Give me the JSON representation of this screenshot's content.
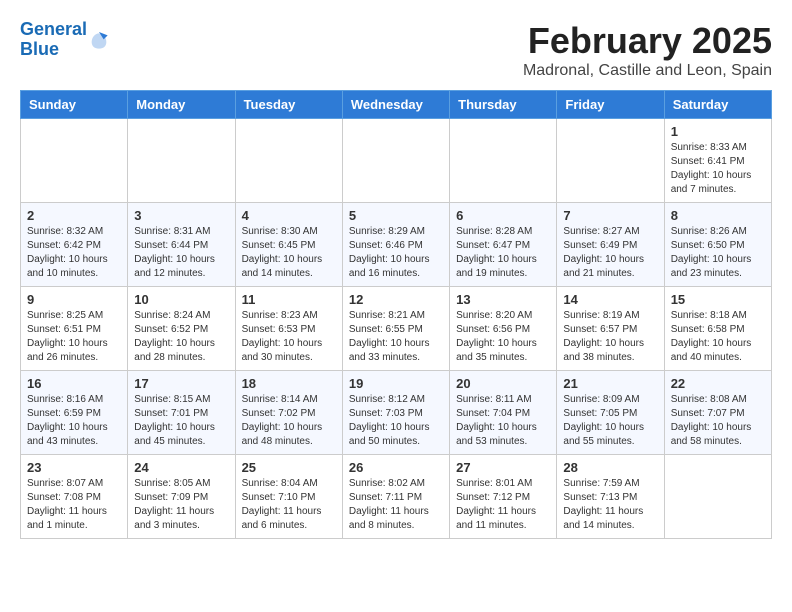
{
  "header": {
    "logo_line1": "General",
    "logo_line2": "Blue",
    "month_year": "February 2025",
    "location": "Madronal, Castille and Leon, Spain"
  },
  "days_of_week": [
    "Sunday",
    "Monday",
    "Tuesday",
    "Wednesday",
    "Thursday",
    "Friday",
    "Saturday"
  ],
  "weeks": [
    [
      {
        "day": "",
        "info": ""
      },
      {
        "day": "",
        "info": ""
      },
      {
        "day": "",
        "info": ""
      },
      {
        "day": "",
        "info": ""
      },
      {
        "day": "",
        "info": ""
      },
      {
        "day": "",
        "info": ""
      },
      {
        "day": "1",
        "info": "Sunrise: 8:33 AM\nSunset: 6:41 PM\nDaylight: 10 hours\nand 7 minutes."
      }
    ],
    [
      {
        "day": "2",
        "info": "Sunrise: 8:32 AM\nSunset: 6:42 PM\nDaylight: 10 hours\nand 10 minutes."
      },
      {
        "day": "3",
        "info": "Sunrise: 8:31 AM\nSunset: 6:44 PM\nDaylight: 10 hours\nand 12 minutes."
      },
      {
        "day": "4",
        "info": "Sunrise: 8:30 AM\nSunset: 6:45 PM\nDaylight: 10 hours\nand 14 minutes."
      },
      {
        "day": "5",
        "info": "Sunrise: 8:29 AM\nSunset: 6:46 PM\nDaylight: 10 hours\nand 16 minutes."
      },
      {
        "day": "6",
        "info": "Sunrise: 8:28 AM\nSunset: 6:47 PM\nDaylight: 10 hours\nand 19 minutes."
      },
      {
        "day": "7",
        "info": "Sunrise: 8:27 AM\nSunset: 6:49 PM\nDaylight: 10 hours\nand 21 minutes."
      },
      {
        "day": "8",
        "info": "Sunrise: 8:26 AM\nSunset: 6:50 PM\nDaylight: 10 hours\nand 23 minutes."
      }
    ],
    [
      {
        "day": "9",
        "info": "Sunrise: 8:25 AM\nSunset: 6:51 PM\nDaylight: 10 hours\nand 26 minutes."
      },
      {
        "day": "10",
        "info": "Sunrise: 8:24 AM\nSunset: 6:52 PM\nDaylight: 10 hours\nand 28 minutes."
      },
      {
        "day": "11",
        "info": "Sunrise: 8:23 AM\nSunset: 6:53 PM\nDaylight: 10 hours\nand 30 minutes."
      },
      {
        "day": "12",
        "info": "Sunrise: 8:21 AM\nSunset: 6:55 PM\nDaylight: 10 hours\nand 33 minutes."
      },
      {
        "day": "13",
        "info": "Sunrise: 8:20 AM\nSunset: 6:56 PM\nDaylight: 10 hours\nand 35 minutes."
      },
      {
        "day": "14",
        "info": "Sunrise: 8:19 AM\nSunset: 6:57 PM\nDaylight: 10 hours\nand 38 minutes."
      },
      {
        "day": "15",
        "info": "Sunrise: 8:18 AM\nSunset: 6:58 PM\nDaylight: 10 hours\nand 40 minutes."
      }
    ],
    [
      {
        "day": "16",
        "info": "Sunrise: 8:16 AM\nSunset: 6:59 PM\nDaylight: 10 hours\nand 43 minutes."
      },
      {
        "day": "17",
        "info": "Sunrise: 8:15 AM\nSunset: 7:01 PM\nDaylight: 10 hours\nand 45 minutes."
      },
      {
        "day": "18",
        "info": "Sunrise: 8:14 AM\nSunset: 7:02 PM\nDaylight: 10 hours\nand 48 minutes."
      },
      {
        "day": "19",
        "info": "Sunrise: 8:12 AM\nSunset: 7:03 PM\nDaylight: 10 hours\nand 50 minutes."
      },
      {
        "day": "20",
        "info": "Sunrise: 8:11 AM\nSunset: 7:04 PM\nDaylight: 10 hours\nand 53 minutes."
      },
      {
        "day": "21",
        "info": "Sunrise: 8:09 AM\nSunset: 7:05 PM\nDaylight: 10 hours\nand 55 minutes."
      },
      {
        "day": "22",
        "info": "Sunrise: 8:08 AM\nSunset: 7:07 PM\nDaylight: 10 hours\nand 58 minutes."
      }
    ],
    [
      {
        "day": "23",
        "info": "Sunrise: 8:07 AM\nSunset: 7:08 PM\nDaylight: 11 hours\nand 1 minute."
      },
      {
        "day": "24",
        "info": "Sunrise: 8:05 AM\nSunset: 7:09 PM\nDaylight: 11 hours\nand 3 minutes."
      },
      {
        "day": "25",
        "info": "Sunrise: 8:04 AM\nSunset: 7:10 PM\nDaylight: 11 hours\nand 6 minutes."
      },
      {
        "day": "26",
        "info": "Sunrise: 8:02 AM\nSunset: 7:11 PM\nDaylight: 11 hours\nand 8 minutes."
      },
      {
        "day": "27",
        "info": "Sunrise: 8:01 AM\nSunset: 7:12 PM\nDaylight: 11 hours\nand 11 minutes."
      },
      {
        "day": "28",
        "info": "Sunrise: 7:59 AM\nSunset: 7:13 PM\nDaylight: 11 hours\nand 14 minutes."
      },
      {
        "day": "",
        "info": ""
      }
    ]
  ]
}
